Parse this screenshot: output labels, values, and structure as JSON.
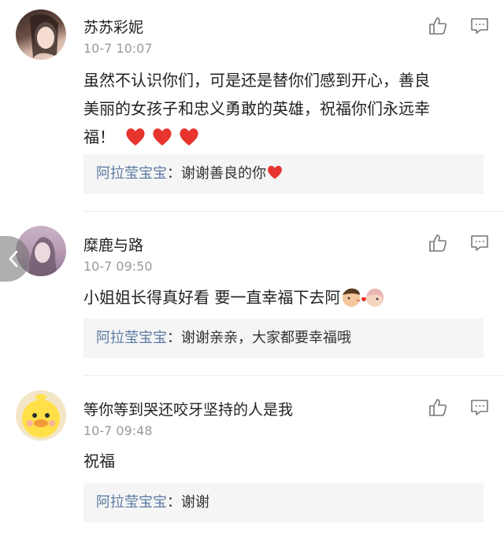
{
  "comments": [
    {
      "name": "苏苏彩妮",
      "time": "10-7 10:07",
      "text_line1": "虽然不认识你们，可是还是替你们感到开心，善良",
      "text_line2": "美丽的女孩子和忠义勇敢的英雄，祝福你们永远幸",
      "text_line3": "福！",
      "reply_author": "阿拉莹宝宝",
      "reply_text": "谢谢善良的你"
    },
    {
      "name": "糜鹿与路",
      "time": "10-7 09:50",
      "text": "小姐姐长得真好看 要一直幸福下去阿",
      "reply_author": "阿拉莹宝宝",
      "reply_text": "谢谢亲亲，大家都要幸福哦"
    },
    {
      "name": "等你等到哭还咬牙坚持的人是我",
      "time": "10-7 09:48",
      "text": "祝福",
      "reply_author": "阿拉莹宝宝",
      "reply_text": "谢谢"
    }
  ],
  "reply_separator": "：",
  "icons": [
    "thumbs-up-icon",
    "comment-icon",
    "heart-icon",
    "back-arrow-icon",
    "kiss-emoji-icon"
  ],
  "colors": {
    "name": "#222222",
    "time": "#9a9a9a",
    "reply_author": "#5b7aa3",
    "reply_bg": "#f5f5f5",
    "heart": "#e8342e"
  }
}
